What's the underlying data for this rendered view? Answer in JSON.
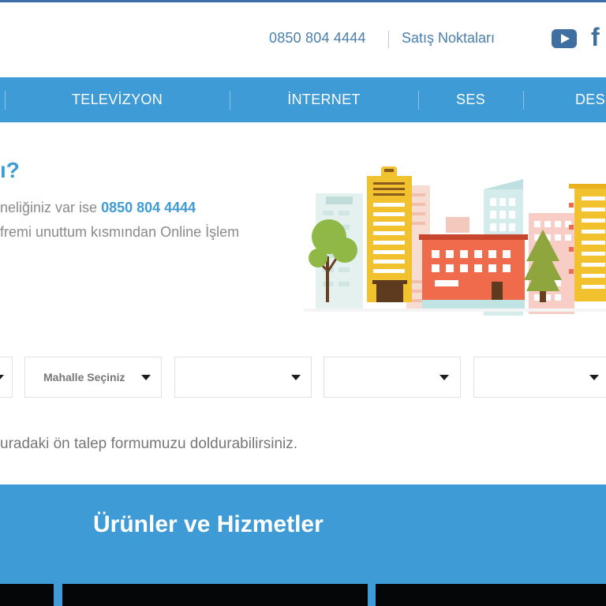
{
  "header": {
    "phone": "0850 804 4444",
    "sales_points": "Satış Noktaları",
    "social_icons": [
      "youtube-icon",
      "facebook-icon"
    ],
    "facebook_glyph": "f"
  },
  "nav": {
    "items": [
      {
        "label": "TELEVİZYON"
      },
      {
        "label": "İNTERNET"
      },
      {
        "label": "SES"
      },
      {
        "label": "DES"
      }
    ]
  },
  "hero": {
    "title": "ı?",
    "line1_prefix": "neliğiniz var ise ",
    "line1_phone": "0850 804 4444",
    "line2": "fremi unuttum kısmından Online İşlem"
  },
  "address_form": {
    "selects": [
      {
        "label": ""
      },
      {
        "label": "Mahalle Seçiniz"
      },
      {
        "label": ""
      },
      {
        "label": ""
      },
      {
        "label": ""
      }
    ]
  },
  "note": "uradaki ön talep formumuzu doldurabilirsiniz.",
  "products": {
    "title": "Ürünler ve Hizmetler"
  },
  "colors": {
    "brand_blue": "#3f9bd6",
    "link_blue": "#4a7fae",
    "text_gray": "#8a8a8a"
  }
}
